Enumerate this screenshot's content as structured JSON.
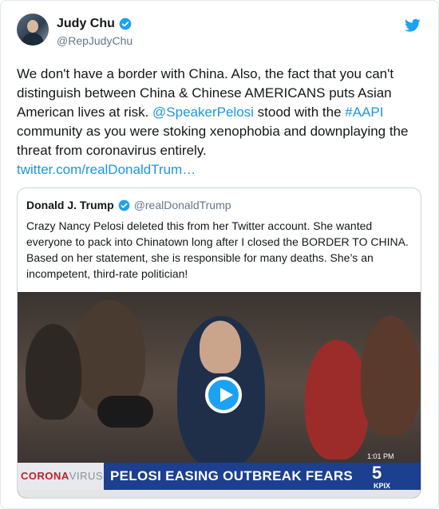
{
  "tweet": {
    "author_name": "Judy Chu",
    "author_handle": "@RepJudyChu",
    "text_part1": "We don't have a border with China. Also, the fact that you can't distinguish between China & Chinese AMERICANS puts Asian American lives at risk. ",
    "mention": "@SpeakerPelosi",
    "text_part2": " stood with the ",
    "hashtag": "#AAPI",
    "text_part3": " community as you were stoking xenophobia and downplaying the threat from coronavirus entirely.",
    "link": "twitter.com/realDonaldTrum…"
  },
  "quoted_tweet": {
    "author_name": "Donald J. Trump",
    "author_handle": "@realDonaldTrump",
    "text": "Crazy Nancy Pelosi deleted this from her Twitter account. She wanted everyone to pack into Chinatown long after I closed the BORDER TO CHINA. Based on her statement, she is responsible for many deaths. She’s an incompetent, third-rate politician!"
  },
  "video": {
    "chyron_tag_red": "CORONA",
    "chyron_tag_gray": "VIRUS",
    "headline": "PELOSI EASING OUTBREAK FEARS",
    "time": "1:01 PM",
    "station_number": "5",
    "station_call": "KPIX"
  },
  "colors": {
    "link": "#1b95e0",
    "verified": "#1da1f2",
    "chyron_bar": "#1c3f8f"
  },
  "icons": [
    "twitter-bird-icon",
    "verified-badge-icon",
    "play-icon"
  ]
}
